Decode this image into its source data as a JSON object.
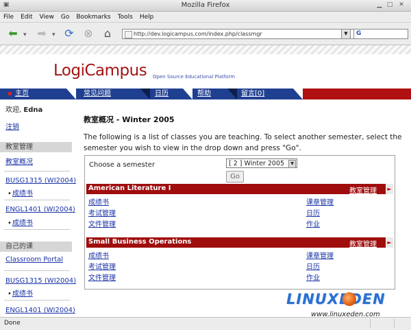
{
  "browser": {
    "window_title": "Mozilla Firefox",
    "menu": [
      "File",
      "Edit",
      "View",
      "Go",
      "Bookmarks",
      "Tools",
      "Help"
    ],
    "url": "http://dev.logicampus.com/index.php/classmgr",
    "status": "Done"
  },
  "site": {
    "logo": "LogiCampus",
    "tagline": "Open Source Educational Platform",
    "nav": [
      "主页",
      "常见问题",
      "日历",
      "帮助",
      "留言[0]"
    ]
  },
  "sidebar": {
    "welcome_prefix": "欢迎, ",
    "welcome_name": "Edna",
    "logout": "注销",
    "section1": "教室管理",
    "section1_link": "教室概况",
    "course1": "BUSG1315 (WI2004)",
    "course1_sub": "成绩书",
    "course2": "ENGL1401 (WI2004)",
    "course2_sub": "成绩书",
    "section2": "自己的课",
    "portal": "Classroom Portal",
    "course3": "BUSG1315 (WI2004)",
    "course3_sub": "成绩书",
    "course4": "ENGL1401 (WI2004)"
  },
  "main": {
    "title": "教室概况 - Winter 2005",
    "description": "The following is a list of classes you are teaching. To select another semester, select the semester you wish to view in the drop down and press \"Go\".",
    "semester_label": "Choose a semester",
    "semester_value": "[ 2 ] Winter 2005",
    "go_label": "Go",
    "courses": [
      {
        "title": "American Literature I",
        "manage": "教室管理",
        "links_left": [
          "成绩书",
          "考试管理",
          "文件管理"
        ],
        "links_right": [
          "课章管理",
          "日历",
          "作业"
        ]
      },
      {
        "title": "Small Business Operations",
        "manage": "教室管理",
        "links_left": [
          "成绩书",
          "考试管理",
          "文件管理"
        ],
        "links_right": [
          "课章管理",
          "日历",
          "作业"
        ]
      }
    ]
  },
  "watermark": {
    "text": "LINUXEDEN",
    "url": "www.linuxeden.com"
  }
}
